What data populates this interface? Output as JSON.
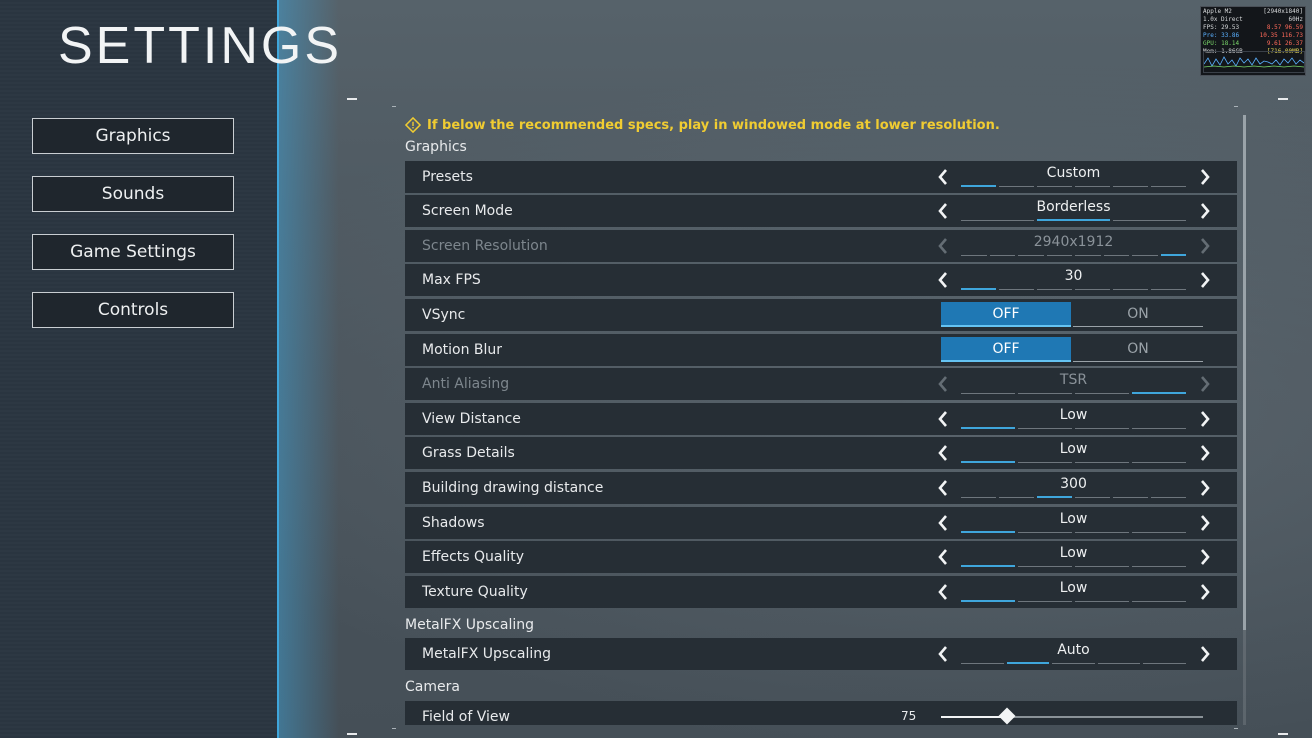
{
  "title": "SETTINGS",
  "nav": [
    {
      "label": "Graphics"
    },
    {
      "label": "Sounds"
    },
    {
      "label": "Game Settings"
    },
    {
      "label": "Controls"
    }
  ],
  "warning": "If below the recommended specs, play in windowed mode at lower resolution.",
  "sections": {
    "graphics": "Graphics",
    "metalfx": "MetalFX Upscaling",
    "camera": "Camera"
  },
  "rows": {
    "presets": {
      "label": "Presets",
      "value": "Custom"
    },
    "screen_mode": {
      "label": "Screen Mode",
      "value": "Borderless"
    },
    "screen_resolution": {
      "label": "Screen Resolution",
      "value": "2940x1912"
    },
    "max_fps": {
      "label": "Max FPS",
      "value": "30"
    },
    "vsync": {
      "label": "VSync",
      "off": "OFF",
      "on": "ON"
    },
    "motion_blur": {
      "label": "Motion Blur",
      "off": "OFF",
      "on": "ON"
    },
    "anti_aliasing": {
      "label": "Anti Aliasing",
      "value": "TSR"
    },
    "view_distance": {
      "label": "View Distance",
      "value": "Low"
    },
    "grass_details": {
      "label": "Grass Details",
      "value": "Low"
    },
    "building_distance": {
      "label": "Building drawing distance",
      "value": "300"
    },
    "shadows": {
      "label": "Shadows",
      "value": "Low"
    },
    "effects_quality": {
      "label": "Effects Quality",
      "value": "Low"
    },
    "texture_quality": {
      "label": "Texture Quality",
      "value": "Low"
    },
    "metalfx_upscaling": {
      "label": "MetalFX Upscaling",
      "value": "Auto"
    },
    "field_of_view": {
      "label": "Field of View",
      "value": "75"
    }
  },
  "fov_slider_fraction": 0.25,
  "colors": {
    "accent": "#3fa6dc",
    "toggle_active": "#1f78b4",
    "warning": "#f0cc32"
  },
  "perf": {
    "device": "Apple M2",
    "resolution": "[2940x1840]",
    "mode": "1.0x Direct",
    "refresh": "60Hz",
    "fps_label": "FPS:",
    "fps_val": "29.53",
    "fps_min": "8.57",
    "fps_max": "96.59",
    "pre_label": "Pre:",
    "pre_val": "33.86",
    "pre_min": "10.35",
    "pre_max": "116.73",
    "gpu_label": "GPU:",
    "gpu_val": "18.14",
    "gpu_min": "9.61",
    "gpu_max": "26.37",
    "mem_label": "Mem:",
    "mem_val": "1.86GB",
    "mem_max": "[716.00MB]"
  }
}
